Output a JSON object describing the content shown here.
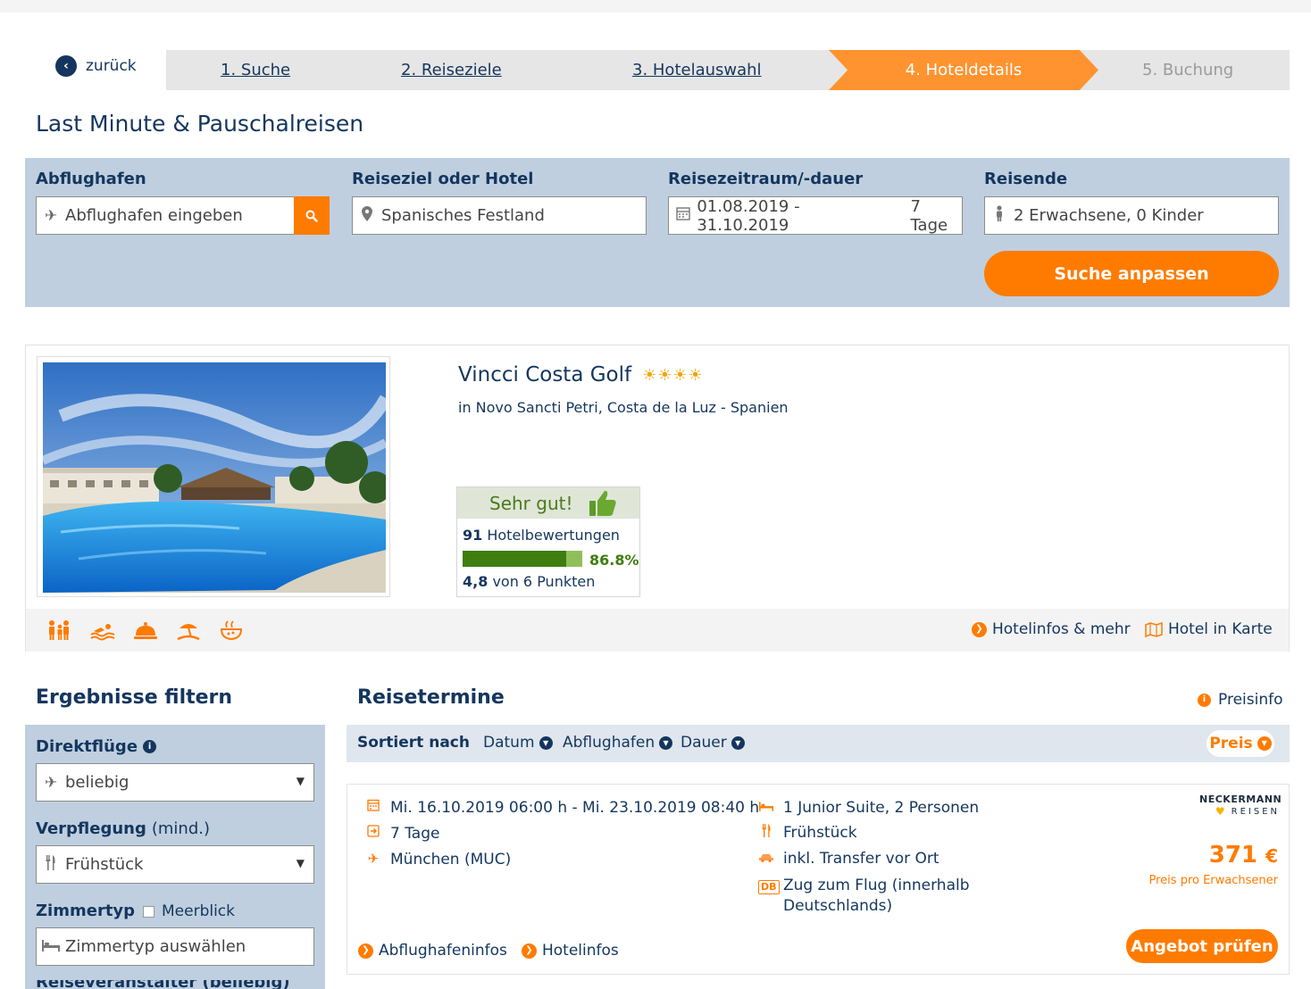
{
  "nav": {
    "back_label": "zurück",
    "steps": [
      {
        "label": "1. Suche"
      },
      {
        "label": "2. Reiseziele"
      },
      {
        "label": "3. Hotelauswahl"
      },
      {
        "label": "4. Hoteldetails"
      },
      {
        "label": "5. Buchung"
      }
    ],
    "active_color": "#ff9330"
  },
  "page_title": "Last Minute & Pauschalreisen",
  "search": {
    "airport_label": "Abflughafen",
    "airport_placeholder": "Abflughafen eingeben",
    "destination_label": "Reiseziel oder Hotel",
    "destination_value": "Spanisches Festland",
    "period_label": "Reisezeitraum/-dauer",
    "period_value": "01.08.2019 - 31.10.2019",
    "duration_value": "7 Tage",
    "travelers_label": "Reisende",
    "travelers_value": "2 Erwachsene, 0 Kinder",
    "submit_label": "Suche anpassen"
  },
  "hotel": {
    "name": "Vincci Costa Golf",
    "stars": 4,
    "location": "in Novo Sancti Petri, Costa de la Luz - Spanien",
    "rating_text": "Sehr gut!",
    "review_count": "91",
    "review_label": "Hotelbewertungen",
    "recommendation_percent": "86.8%",
    "recommendation_fraction": 0.868,
    "score": "4,8",
    "score_suffix": "von 6 Punkten",
    "amenity_icons": [
      "family-icon",
      "swimming-icon",
      "food-service-icon",
      "beach-icon",
      "wellness-icon"
    ],
    "links": {
      "info": "Hotelinfos & mehr",
      "map": "Hotel in Karte"
    }
  },
  "filters": {
    "title": "Ergebnisse filtern",
    "direct_label": "Direktflüge",
    "direct_value": "beliebig",
    "board_label": "Verpflegung",
    "board_suffix": "(mind.)",
    "board_value": "Frühstück",
    "room_label": "Zimmertyp",
    "seaview_label": "Meerblick",
    "room_placeholder": "Zimmertyp auswählen"
  },
  "results": {
    "title": "Reisetermine",
    "price_info": "Preisinfo",
    "sort_label": "Sortiert nach",
    "sort_options": [
      "Datum",
      "Abflughafen",
      "Dauer"
    ],
    "sort_active": "Preis"
  },
  "offer": {
    "dates": "Mi. 16.10.2019 06:00 h - Mi. 23.10.2019 08:40 h",
    "duration": "7 Tage",
    "airport": "München (MUC)",
    "room": "1 Junior Suite, 2 Personen",
    "board": "Frühstück",
    "transfer": "inkl. Transfer vor Ort",
    "train_line1": "Zug zum Flug (innerhalb",
    "train_line2": "Deutschlands)",
    "train_badge": "DB",
    "brand_line1": "NECKERMANN",
    "brand_line2": "REISEN",
    "price": "371",
    "currency": "€",
    "price_note": "Preis pro Erwachsener",
    "airport_info": "Abflughafeninfos",
    "hotel_info": "Hotelinfos",
    "check_label": "Angebot prüfen"
  },
  "colors": {
    "navy": "#14365e",
    "orange": "#ff7b00",
    "panel": "#bfcfdf",
    "rating_green": "#3e7d0e"
  }
}
